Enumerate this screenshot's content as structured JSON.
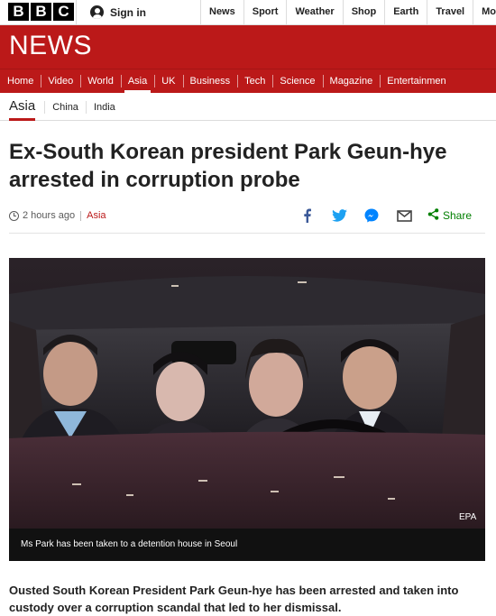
{
  "brand": {
    "letters": [
      "B",
      "B",
      "C"
    ],
    "news_label": "NEWS",
    "news_color": "#bb1919"
  },
  "account": {
    "signin_label": "Sign in",
    "icon": "user-icon"
  },
  "top_nav": [
    "News",
    "Sport",
    "Weather",
    "Shop",
    "Earth",
    "Travel",
    "Mo"
  ],
  "section_nav": {
    "items": [
      "Home",
      "Video",
      "World",
      "Asia",
      "UK",
      "Business",
      "Tech",
      "Science",
      "Magazine",
      "Entertainmen"
    ],
    "active": "Asia"
  },
  "sub_nav": {
    "current": "Asia",
    "links": [
      "China",
      "India"
    ]
  },
  "article": {
    "headline": "Ex-South Korean president Park Geun-hye arrested in corruption probe",
    "timestamp": "2 hours ago",
    "section": "Asia",
    "share_label": "Share",
    "share_icons": [
      "facebook-icon",
      "twitter-icon",
      "messenger-icon",
      "email-icon",
      "share-icon"
    ],
    "share_color": "#007f00",
    "image_credit": "EPA",
    "image_caption": "Ms Park has been taken to a detention house in Seoul",
    "intro": "Ousted South Korean President Park Geun-hye has been arrested and taken into custody over a corruption scandal that led to her dismissal."
  }
}
